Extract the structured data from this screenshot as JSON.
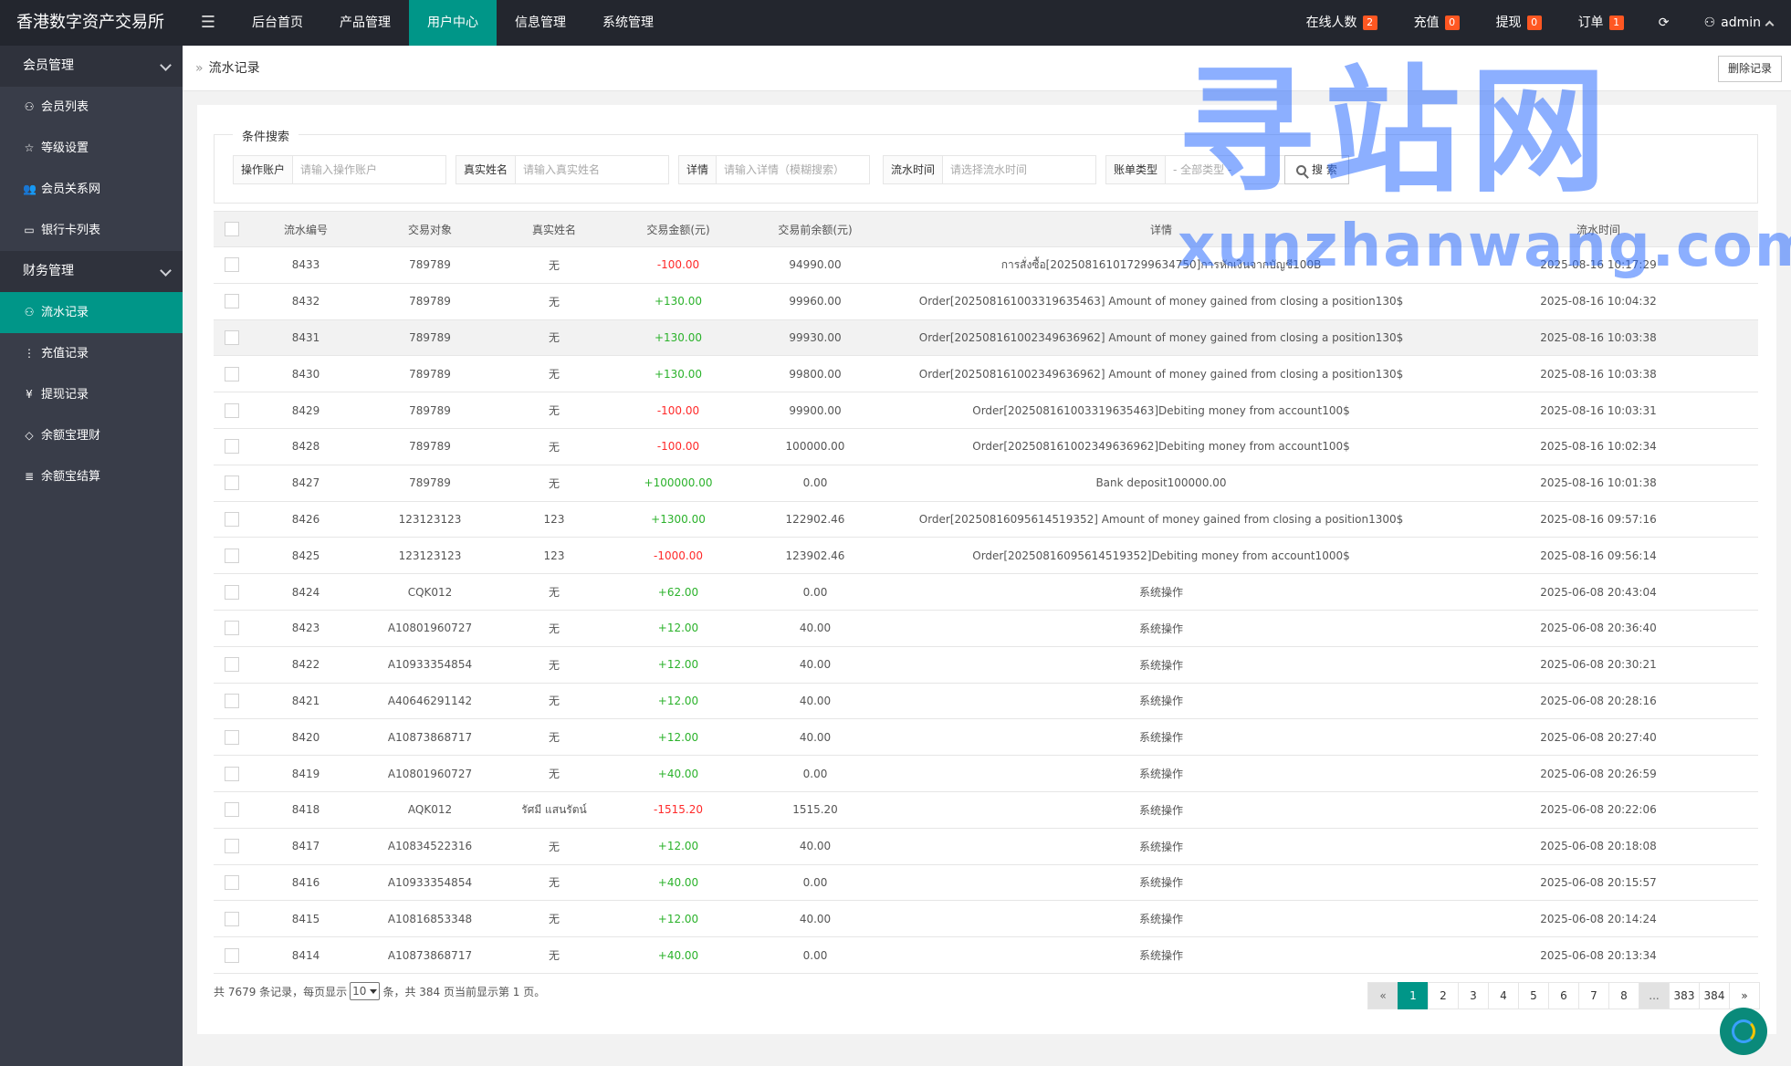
{
  "app": {
    "title": "香港数字资产交易所"
  },
  "topnav": {
    "items": [
      {
        "label": "后台首页",
        "active": false
      },
      {
        "label": "产品管理",
        "active": false
      },
      {
        "label": "用户中心",
        "active": true
      },
      {
        "label": "信息管理",
        "active": false
      },
      {
        "label": "系统管理",
        "active": false
      }
    ],
    "online": {
      "label": "在线人数",
      "count": "2"
    },
    "recharge": {
      "label": "充值",
      "count": "0"
    },
    "withdraw": {
      "label": "提现",
      "count": "0"
    },
    "orders": {
      "label": "订单",
      "count": "1"
    },
    "user": "admin"
  },
  "sidebar": {
    "group1": "会员管理",
    "group1_items": [
      {
        "label": "会员列表",
        "icon": "user-icon"
      },
      {
        "label": "等级设置",
        "icon": "star-icon"
      },
      {
        "label": "会员关系网",
        "icon": "users-icon"
      },
      {
        "label": "银行卡列表",
        "icon": "card-icon"
      }
    ],
    "group2": "财务管理",
    "group2_items": [
      {
        "label": "流水记录",
        "icon": "user-icon",
        "active": true
      },
      {
        "label": "充值记录",
        "icon": "dots-icon"
      },
      {
        "label": "提现记录",
        "icon": "yen-icon"
      },
      {
        "label": "余额宝理财",
        "icon": "diamond-icon"
      },
      {
        "label": "余额宝结算",
        "icon": "list-icon"
      }
    ]
  },
  "page": {
    "breadcrumb": "流水记录",
    "delete_button": "删除记录"
  },
  "search": {
    "legend": "条件搜索",
    "account_label": "操作账户",
    "account_placeholder": "请输入操作账户",
    "name_label": "真实姓名",
    "name_placeholder": "请输入真实姓名",
    "detail_label": "详情",
    "detail_placeholder": "请输入详情（模糊搜索）",
    "time_label": "流水时间",
    "time_placeholder": "请选择流水时间",
    "type_label": "账单类型",
    "type_value": "- 全部类型 -",
    "button": "搜 索"
  },
  "table": {
    "headers": [
      "流水编号",
      "交易对象",
      "真实姓名",
      "交易金额(元)",
      "交易前余额(元)",
      "详情",
      "流水时间"
    ],
    "rows": [
      {
        "id": "8433",
        "target": "789789",
        "name": "无",
        "amount": "-100.00",
        "sign": "neg",
        "before": "94990.00",
        "detail": "การสั่งซื้อ[20250816101729963475​0]การหักเงินจากบัญชี100B",
        "time": "2025-08-16 10:17:29"
      },
      {
        "id": "8432",
        "target": "789789",
        "name": "无",
        "amount": "+130.00",
        "sign": "pos",
        "before": "99960.00",
        "detail": "Order[20250816100331963546​3] Amount of money gained from closing a position130$",
        "time": "2025-08-16 10:04:32"
      },
      {
        "id": "8431",
        "target": "789789",
        "name": "无",
        "amount": "+130.00",
        "sign": "pos",
        "before": "99930.00",
        "detail": "Order[20250816100234963696​2] Amount of money gained from closing a position130$",
        "time": "2025-08-16 10:03:38"
      },
      {
        "id": "8430",
        "target": "789789",
        "name": "无",
        "amount": "+130.00",
        "sign": "pos",
        "before": "99800.00",
        "detail": "Order[20250816100234963696​2] Amount of money gained from closing a position130$",
        "time": "2025-08-16 10:03:38"
      },
      {
        "id": "8429",
        "target": "789789",
        "name": "无",
        "amount": "-100.00",
        "sign": "neg",
        "before": "99900.00",
        "detail": "Order[20250816100331963546​3]Debiting money from account100$",
        "time": "2025-08-16 10:03:31"
      },
      {
        "id": "8428",
        "target": "789789",
        "name": "无",
        "amount": "-100.00",
        "sign": "neg",
        "before": "100000.00",
        "detail": "Order[20250816100234963696​2]Debiting money from account100$",
        "time": "2025-08-16 10:02:34"
      },
      {
        "id": "8427",
        "target": "789789",
        "name": "无",
        "amount": "+100000.00",
        "sign": "pos",
        "before": "0.00",
        "detail": "Bank deposit100000.00",
        "time": "2025-08-16 10:01:38"
      },
      {
        "id": "8426",
        "target": "123123123",
        "name": "123",
        "amount": "+1300.00",
        "sign": "pos",
        "before": "122902.46",
        "detail": "Order[20250816095614519352] Amount of money gained from closing a position1300$",
        "time": "2025-08-16 09:57:16"
      },
      {
        "id": "8425",
        "target": "123123123",
        "name": "123",
        "amount": "-1000.00",
        "sign": "neg",
        "before": "123902.46",
        "detail": "Order[20250816095614519352]Debiting money from account1000$",
        "time": "2025-08-16 09:56:14"
      },
      {
        "id": "8424",
        "target": "CQK012",
        "name": "无",
        "amount": "+62.00",
        "sign": "pos",
        "before": "0.00",
        "detail": "系统操作",
        "time": "2025-06-08 20:43:04"
      },
      {
        "id": "8423",
        "target": "A10801960727",
        "name": "无",
        "amount": "+12.00",
        "sign": "pos",
        "before": "40.00",
        "detail": "系统操作",
        "time": "2025-06-08 20:36:40"
      },
      {
        "id": "8422",
        "target": "A10933354854",
        "name": "无",
        "amount": "+12.00",
        "sign": "pos",
        "before": "40.00",
        "detail": "系统操作",
        "time": "2025-06-08 20:30:21"
      },
      {
        "id": "8421",
        "target": "A40646291142",
        "name": "无",
        "amount": "+12.00",
        "sign": "pos",
        "before": "40.00",
        "detail": "系统操作",
        "time": "2025-06-08 20:28:16"
      },
      {
        "id": "8420",
        "target": "A10873868717",
        "name": "无",
        "amount": "+12.00",
        "sign": "pos",
        "before": "40.00",
        "detail": "系统操作",
        "time": "2025-06-08 20:27:40"
      },
      {
        "id": "8419",
        "target": "A10801960727",
        "name": "无",
        "amount": "+40.00",
        "sign": "pos",
        "before": "0.00",
        "detail": "系统操作",
        "time": "2025-06-08 20:26:59"
      },
      {
        "id": "8418",
        "target": "AQK012",
        "name": "รัศมี แสนรัตน์",
        "amount": "-1515.20",
        "sign": "neg",
        "before": "1515.20",
        "detail": "系统操作",
        "time": "2025-06-08 20:22:06"
      },
      {
        "id": "8417",
        "target": "A10834522316",
        "name": "无",
        "amount": "+12.00",
        "sign": "pos",
        "before": "40.00",
        "detail": "系统操作",
        "time": "2025-06-08 20:18:08"
      },
      {
        "id": "8416",
        "target": "A10933354854",
        "name": "无",
        "amount": "+40.00",
        "sign": "pos",
        "before": "0.00",
        "detail": "系统操作",
        "time": "2025-06-08 20:15:57"
      },
      {
        "id": "8415",
        "target": "A10816853348",
        "name": "无",
        "amount": "+12.00",
        "sign": "pos",
        "before": "40.00",
        "detail": "系统操作",
        "time": "2025-06-08 20:14:24"
      },
      {
        "id": "8414",
        "target": "A10873868717",
        "name": "无",
        "amount": "+40.00",
        "sign": "pos",
        "before": "0.00",
        "detail": "系统操作",
        "time": "2025-06-08 20:13:34"
      }
    ]
  },
  "pagination": {
    "info_prefix": "共 7679 条记录，每页显示",
    "page_size": "10",
    "info_suffix": "条，共 384 页当前显示第 1 页。",
    "pages": [
      "«",
      "1",
      "2",
      "3",
      "4",
      "5",
      "6",
      "7",
      "8",
      "...",
      "383",
      "384",
      "»"
    ],
    "current": "1"
  },
  "watermark": {
    "big": "寻站网",
    "small": "xunzhanwang.com"
  },
  "colors": {
    "accent": "#009688",
    "header": "#23262e",
    "sidebar": "#393d49",
    "negative": "#ff2a2a",
    "positive": "#2bb22b",
    "badge": "#ff5722"
  }
}
